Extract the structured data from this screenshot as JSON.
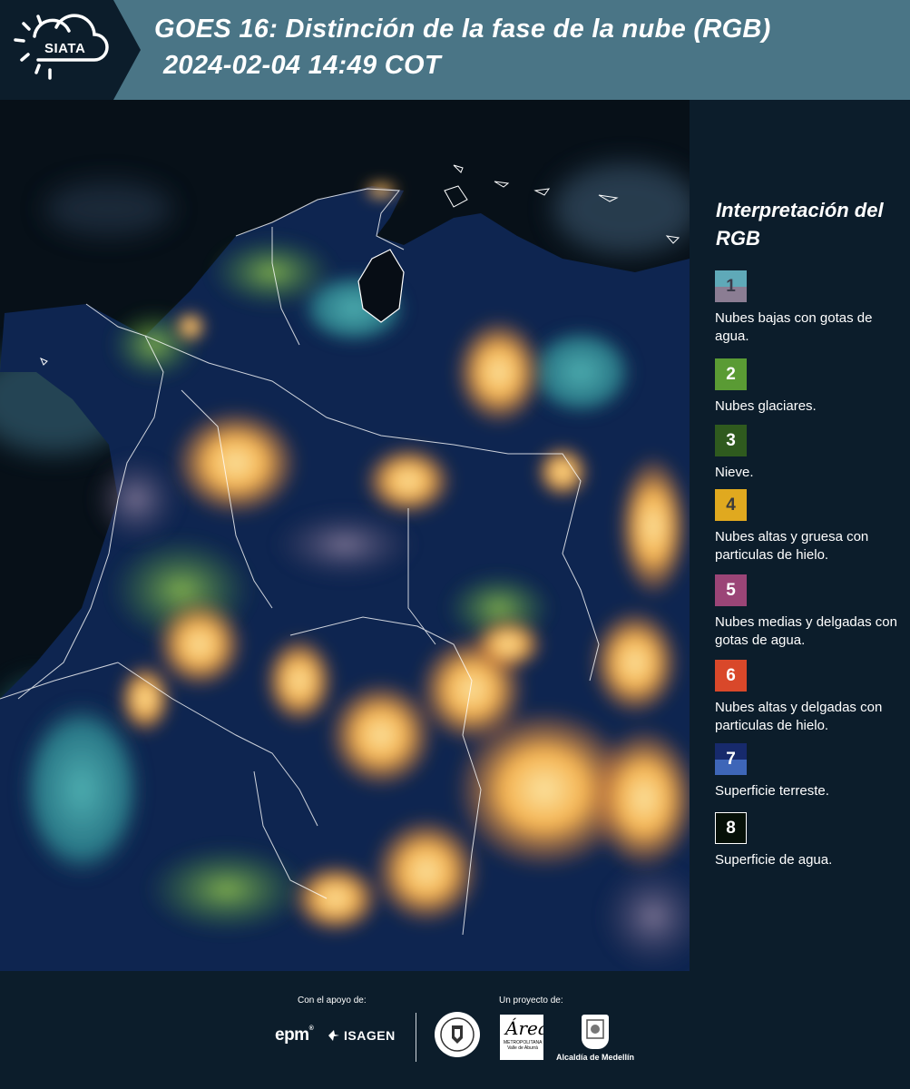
{
  "header": {
    "logo_text": "SIATA",
    "title_line1": "GOES 16: Distinción de la fase de la nube (RGB)",
    "title_line2": "2024-02-04 14:49 COT"
  },
  "legend": {
    "title": "Interpretación del RGB",
    "items": [
      {
        "number": "1",
        "label": "Nubes bajas con gotas de agua.",
        "color_top": "#5fa9b8",
        "color_bottom": "#8b7d93",
        "num_color": "#3b3b4a"
      },
      {
        "number": "2",
        "label": "Nubes glaciares.",
        "color_top": "#5a9b34",
        "color_bottom": "#5a9b34",
        "num_color": "#ffffff"
      },
      {
        "number": "3",
        "label": "Nieve.",
        "color_top": "#2f5a1e",
        "color_bottom": "#2f5a1e",
        "num_color": "#ffffff"
      },
      {
        "number": "4",
        "label": "Nubes altas y gruesa con particulas de hielo.",
        "color_top": "#e0a91f",
        "color_bottom": "#e0a91f",
        "num_color": "#3b3b3b"
      },
      {
        "number": "5",
        "label": "Nubes medias y delgadas con gotas de agua.",
        "color_top": "#9b4577",
        "color_bottom": "#9b4577",
        "num_color": "#ffffff"
      },
      {
        "number": "6",
        "label": "Nubes altas y delgadas con particulas de hielo.",
        "color_top": "#d9482a",
        "color_bottom": "#d9482a",
        "num_color": "#ffffff"
      },
      {
        "number": "7",
        "label": "Superficie terreste.",
        "color_top": "#172a6c",
        "color_bottom": "#3e66b8",
        "num_color": "#ffffff"
      },
      {
        "number": "8",
        "label": "Superficie de agua.",
        "color_top": "#061008",
        "color_bottom": "#061008",
        "num_color": "#ffffff"
      }
    ]
  },
  "footer": {
    "support_label": "Con el apoyo de:",
    "project_label": "Un proyecto de:",
    "epm": "epm",
    "isagen": "ISAGEN",
    "amva_text": "METROPOLITANA Valle de Aburrá",
    "medellin": "Alcaldía de Medellín"
  },
  "colors": {
    "header_bg": "#4a7586",
    "logo_bg": "#0c1d2b",
    "page_bg": "#0c1d2b",
    "cloud_orange": "#f2a43a",
    "cloud_yellow": "#f7d77a",
    "cyan_low_cloud": "#47c2c2",
    "land": "#0e2550"
  }
}
